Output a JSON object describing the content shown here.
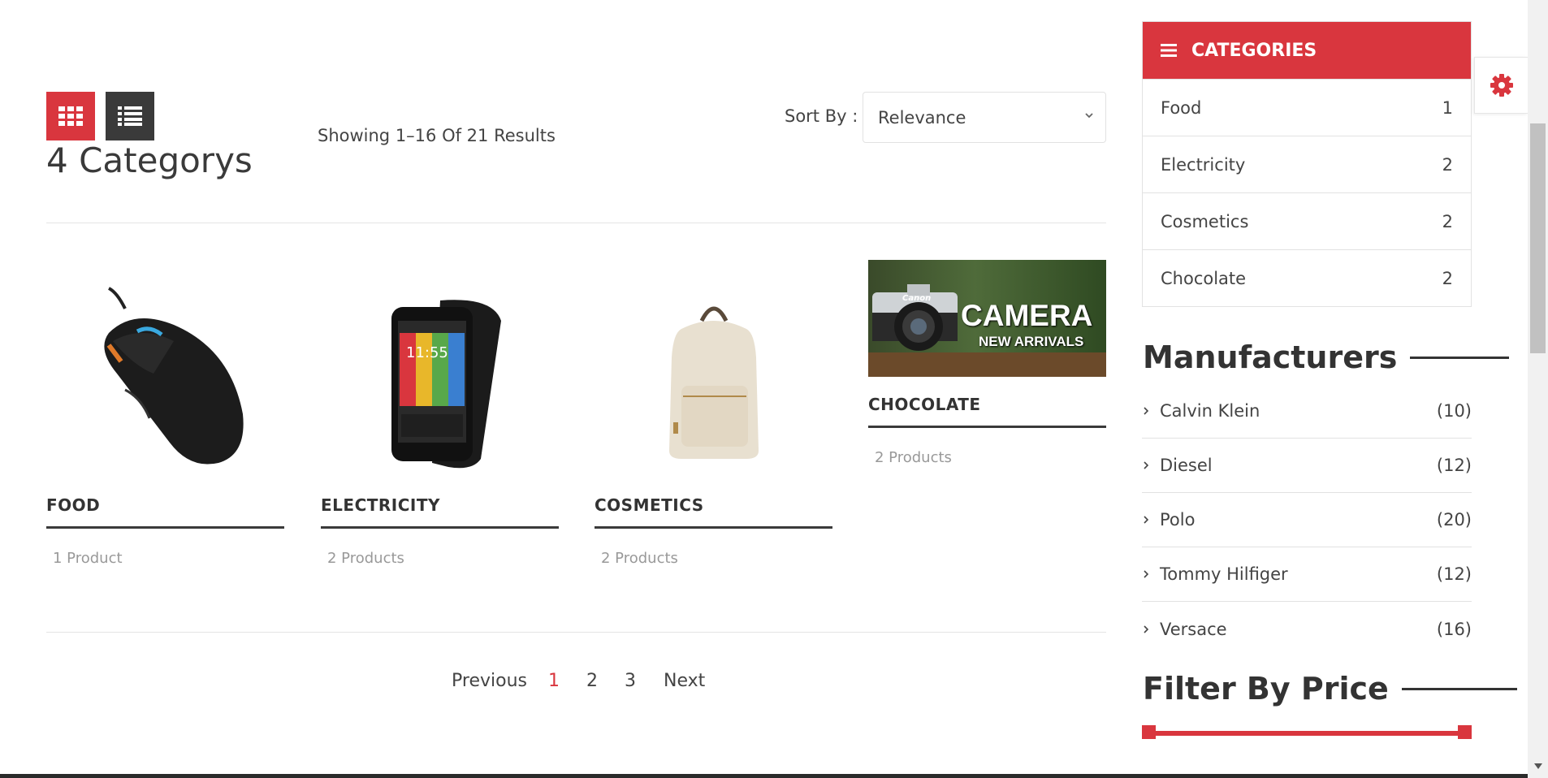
{
  "title": "4 Categorys",
  "results_text": "Showing 1–16 Of 21 Results",
  "sort": {
    "label": "Sort By :",
    "selected": "Relevance"
  },
  "view_toggle": {
    "grid_icon": "grid-icon",
    "list_icon": "list-icon",
    "active": "grid"
  },
  "categories_grid": [
    {
      "name": "FOOD",
      "count": "1 Product",
      "image": "computer-mouse"
    },
    {
      "name": "ELECTRICITY",
      "count": "2 Products",
      "image": "smartphone"
    },
    {
      "name": "COSMETICS",
      "count": "2 Products",
      "image": "backpack"
    },
    {
      "name": "CHOCOLATE",
      "count": "2 Products",
      "image": "camera-banner",
      "banner_title": "CAMERA",
      "banner_subtitle": "NEW ARRIVALS",
      "banner_brand": "Canon"
    }
  ],
  "pagination": {
    "previous": "Previous",
    "pages": [
      "1",
      "2",
      "3"
    ],
    "current": "1",
    "next": "Next"
  },
  "sidebar": {
    "categories_title": "CATEGORIES",
    "categories": [
      {
        "name": "Food",
        "count": "1"
      },
      {
        "name": "Electricity",
        "count": "2"
      },
      {
        "name": "Cosmetics",
        "count": "2"
      },
      {
        "name": "Chocolate",
        "count": "2"
      }
    ],
    "manufacturers_title": "Manufacturers",
    "manufacturers": [
      {
        "name": "Calvin Klein",
        "count": "(10)"
      },
      {
        "name": "Diesel",
        "count": "(12)"
      },
      {
        "name": "Polo",
        "count": "(20)"
      },
      {
        "name": "Tommy Hilfiger",
        "count": "(12)"
      },
      {
        "name": "Versace",
        "count": "(16)"
      }
    ],
    "price_title": "Filter By Price"
  },
  "colors": {
    "accent": "#d9363e",
    "dark": "#3a3a3a"
  }
}
